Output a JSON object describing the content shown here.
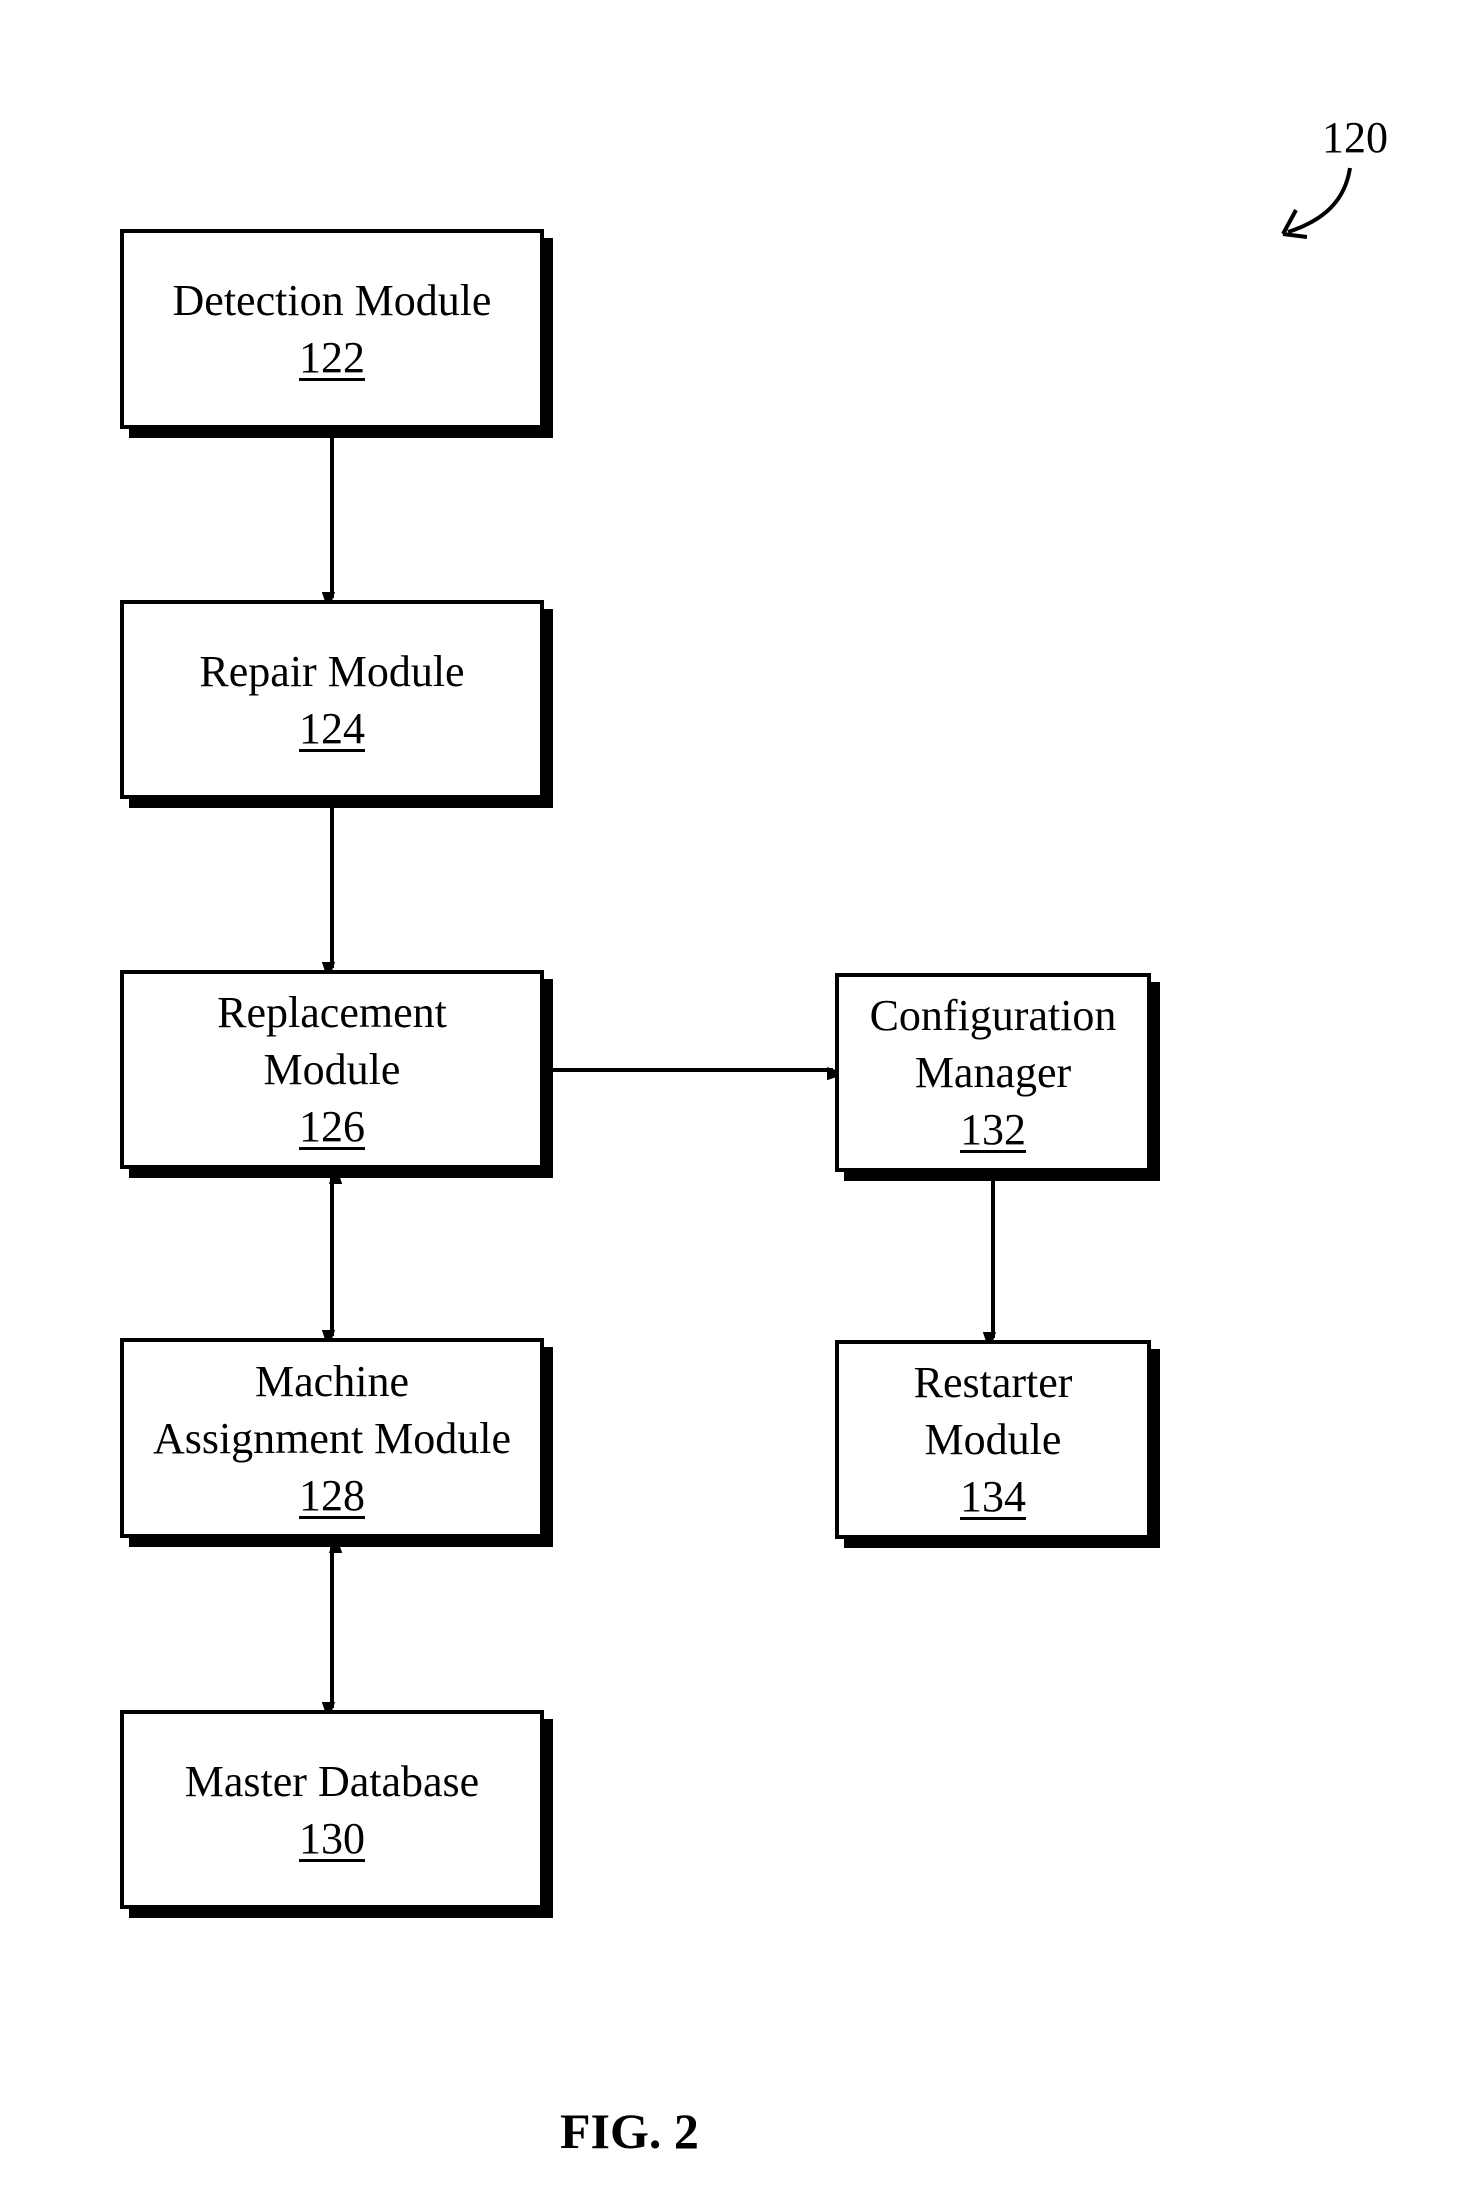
{
  "figure": {
    "reference_label": "120",
    "caption": "FIG. 2"
  },
  "modules": [
    {
      "id": "detection",
      "name_lines": [
        "Detection Module"
      ],
      "ref": "122"
    },
    {
      "id": "repair",
      "name_lines": [
        "Repair Module"
      ],
      "ref": "124"
    },
    {
      "id": "replacement",
      "name_lines": [
        "Replacement",
        "Module"
      ],
      "ref": "126"
    },
    {
      "id": "machine-assignment",
      "name_lines": [
        "Machine",
        "Assignment Module"
      ],
      "ref": "128"
    },
    {
      "id": "master-database",
      "name_lines": [
        "Master Database"
      ],
      "ref": "130"
    },
    {
      "id": "configuration-manager",
      "name_lines": [
        "Configuration",
        "Manager"
      ],
      "ref": "132"
    },
    {
      "id": "restarter",
      "name_lines": [
        "Restarter",
        "Module"
      ],
      "ref": "134"
    }
  ],
  "connections": [
    {
      "from": "detection",
      "to": "repair",
      "type": "one-way"
    },
    {
      "from": "repair",
      "to": "replacement",
      "type": "one-way"
    },
    {
      "from": "replacement",
      "to": "machine-assignment",
      "type": "two-way"
    },
    {
      "from": "machine-assignment",
      "to": "master-database",
      "type": "two-way"
    },
    {
      "from": "replacement",
      "to": "configuration-manager",
      "type": "one-way"
    },
    {
      "from": "configuration-manager",
      "to": "restarter",
      "type": "one-way"
    }
  ]
}
